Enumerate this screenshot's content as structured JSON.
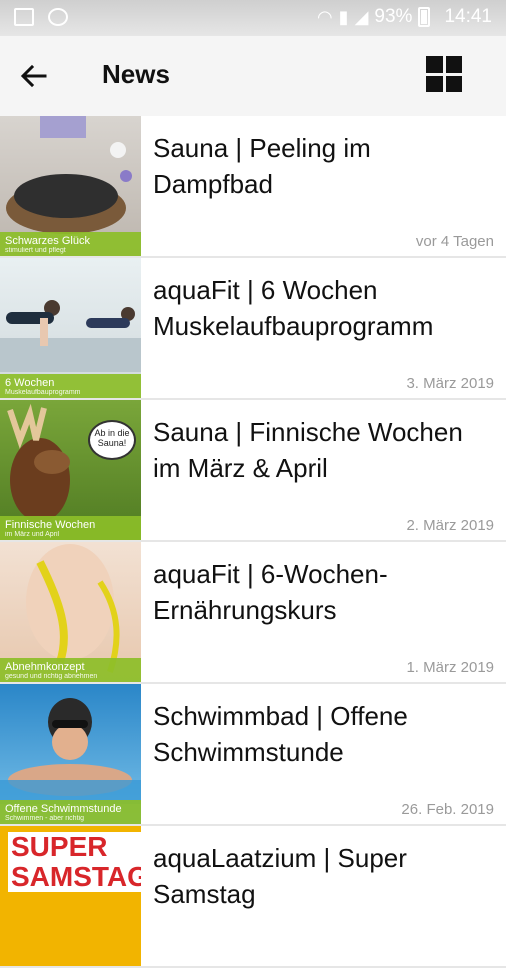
{
  "status_bar": {
    "battery": "93%",
    "time": "14:41"
  },
  "app_bar": {
    "title": "News",
    "back_icon": "arrow-left-icon",
    "view_icon": "grid-view-icon"
  },
  "news": [
    {
      "title": "Sauna | Peeling im Dampfbad",
      "date": "vor 4 Tagen",
      "thumb_caption": "Schwarzes Glück",
      "thumb_subcaption": "stimuliert und pflegt"
    },
    {
      "title": "aquaFit | 6 Wochen Muskelaufbauprogramm",
      "date": "3. März 2019",
      "thumb_caption": "6 Wochen",
      "thumb_subcaption": "Muskelaufbauprogramm"
    },
    {
      "title": "Sauna | Finnische Wochen im März & April",
      "date": "2. März 2019",
      "thumb_caption": "Finnische Wochen",
      "thumb_subcaption": "im März und April",
      "thumb_bubble": "Ab in die Sauna!"
    },
    {
      "title": "aquaFit | 6-Wochen-Ernährungskurs",
      "date": "1. März 2019",
      "thumb_caption": "Abnehmkonzept",
      "thumb_subcaption": "gesund und richtig abnehmen"
    },
    {
      "title": "Schwimmbad | Offene Schwimmstunde",
      "date": "26. Feb. 2019",
      "thumb_caption": "Offene Schwimmstunde",
      "thumb_subcaption": "Schwimmen - aber richtig"
    },
    {
      "title": "aquaLaatzium | Super Samstag",
      "date": "",
      "thumb_caption": "SUPER SAMSTAG"
    }
  ]
}
